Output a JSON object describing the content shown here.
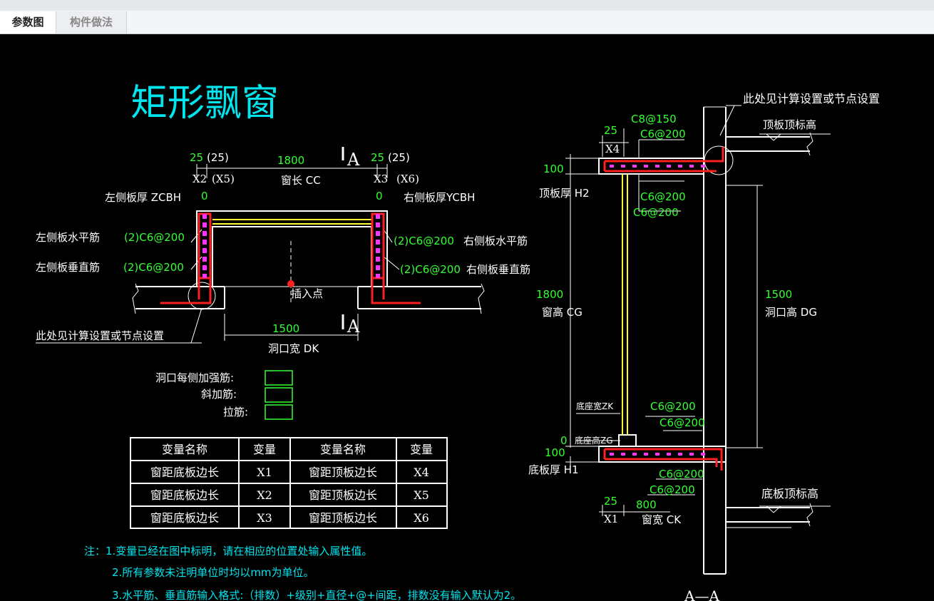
{
  "tabs": [
    {
      "label": "参数图"
    },
    {
      "label": "构件做法"
    }
  ],
  "drawing": {
    "title": "矩形飘窗",
    "plan": {
      "dim_left_a": "25",
      "dim_left_b": "(25)",
      "dim_window_len": "1800",
      "section_mark": "A",
      "dim_right_a": "25",
      "dim_right_b": "(25)",
      "x2": "X2",
      "x5": "(X5)",
      "window_len_label": "窗长 CC",
      "x3": "X3",
      "x6": "(X6)",
      "left_thk_label": "左侧板厚 ZCBH",
      "left_thk_val": "0",
      "right_thk_val": "0",
      "right_thk_label": "右侧板厚YCBH",
      "left_h_label": "左侧板水平筋",
      "left_h_val": "(2)C6@200",
      "right_h_val": "(2)C6@200",
      "right_h_label": "右侧板水平筋",
      "left_v_label": "左侧板垂直筋",
      "left_v_val": "(2)C6@200",
      "right_v_val": "(2)C6@200",
      "right_v_label": "右侧板垂直筋",
      "insert_point": "插入点",
      "node_note": "此处见计算设置或节点设置",
      "opening_width_val": "1500",
      "opening_width_label": "洞口宽 DK"
    },
    "rebar_fields": [
      {
        "label": "洞口每侧加强筋:",
        "value": ""
      },
      {
        "label": "斜加筋:",
        "value": ""
      },
      {
        "label": "拉筋:",
        "value": ""
      }
    ],
    "table": {
      "headers": [
        "变量名称",
        "变量",
        "变量名称",
        "变量"
      ],
      "rows": [
        [
          "窗距底板边长",
          "X1",
          "窗距顶板边长",
          "X4"
        ],
        [
          "窗距底板边长",
          "X2",
          "窗距顶板边长",
          "X5"
        ],
        [
          "窗距底板边长",
          "X3",
          "窗距顶板边长",
          "X6"
        ]
      ]
    },
    "notes": [
      "注：1.变量已经在图中标明，请在相应的位置处输入属性值。",
      "2.所有参数未注明单位时均以mm为单位。",
      "3.水平筋、垂直筋输入格式:（排数）+级别+直径+@+间距，排数没有输入默认为2。"
    ],
    "section": {
      "node_note": "此处见计算设置或节点设置",
      "top_elev": "顶板顶标高",
      "c8": "C8@150",
      "top_dim25": "25",
      "x4": "X4",
      "top_c6_a": "C6@200",
      "top_thk_val": "100",
      "top_thk_label": "顶板厚 H2",
      "top_c6_b": "C6@200",
      "top_c6_c": "C6@200",
      "win_h_val": "1800",
      "win_h_label": "窗高 CG",
      "open_h_val": "1500",
      "open_h_label": "洞口高 DG",
      "base_w_label": "底座宽ZK",
      "bot_c6_a": "C6@200",
      "bot_c6_b": "C6@200",
      "base_h_val": "0",
      "base_h_label": "底座高ZG",
      "bot_thk_val": "100",
      "bot_thk_label": "底板厚 H1",
      "bot_c6_c": "C6@200",
      "bot_c6_d": "C6@200",
      "bot_elev": "底板顶标高",
      "bot_dim25": "25",
      "x1": "X1",
      "win_w_val": "800",
      "win_w_label": "窗宽 CK",
      "section_title": "A—A"
    }
  }
}
